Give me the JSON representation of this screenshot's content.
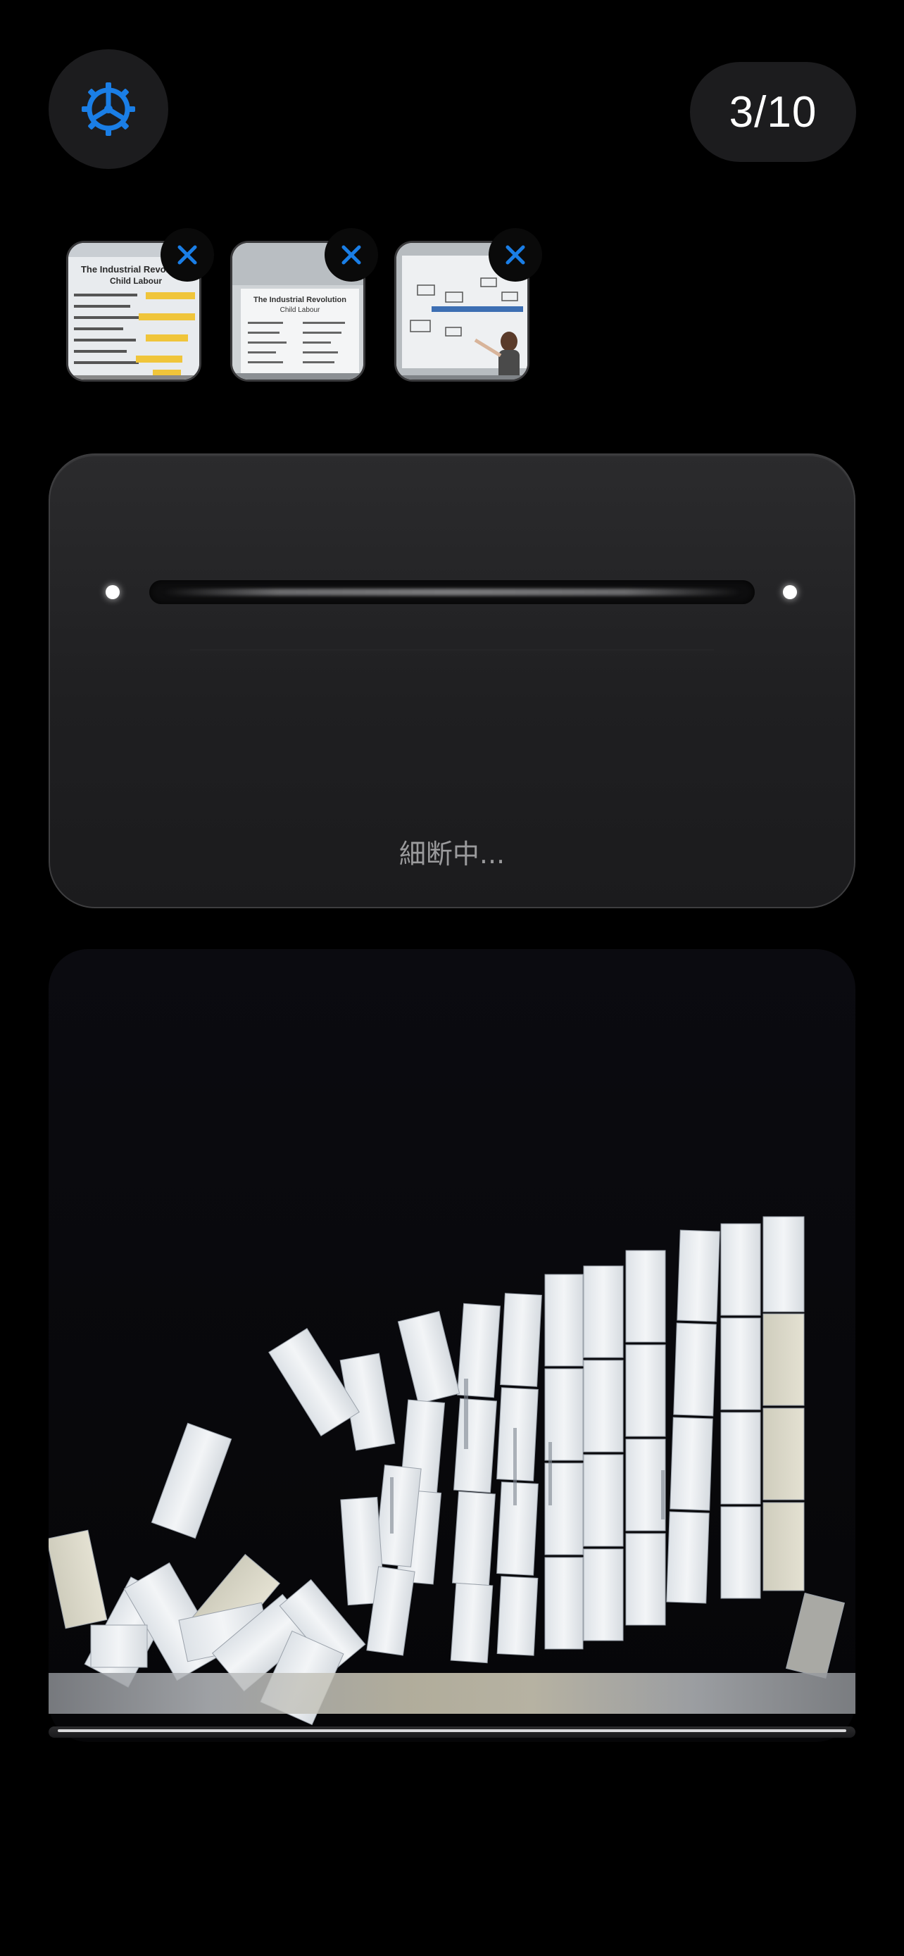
{
  "counter": {
    "label": "3/10"
  },
  "settings": {
    "icon": "gear-icon",
    "accent": "#1a7ee6"
  },
  "thumbnails": [
    {
      "title": "The Industrial Revolution",
      "subtitle": "Child Labour"
    },
    {
      "title": "The Industrial Revolution",
      "subtitle": "Child Labour"
    },
    {
      "title": ""
    }
  ],
  "shredder": {
    "status": "細断中..."
  },
  "colors": {
    "background": "#000000",
    "panel": "#1f1f21",
    "accent": "#1a7ee6"
  }
}
